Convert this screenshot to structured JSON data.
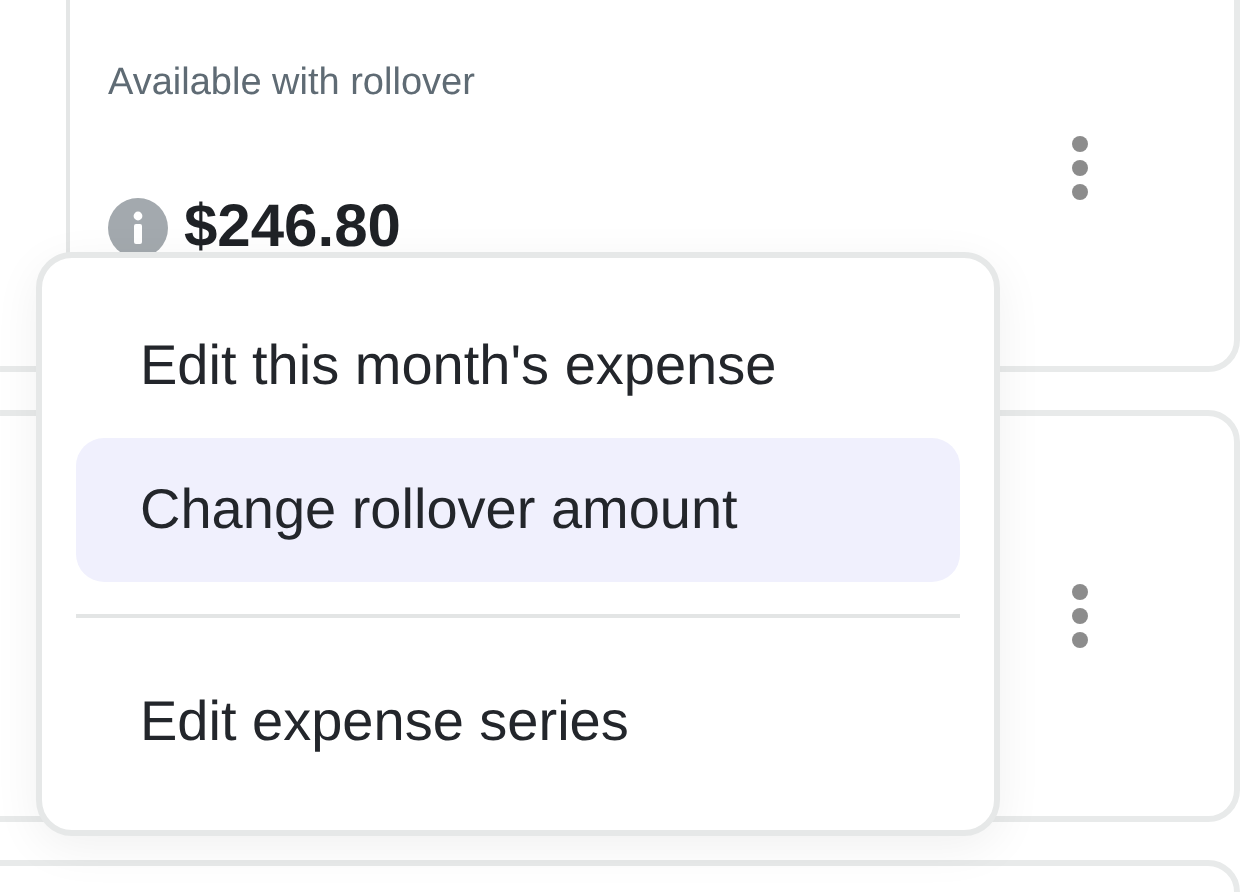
{
  "budget_card": {
    "label": "Available with rollover",
    "amount": "$246.80"
  },
  "menu": {
    "items": [
      {
        "kind": "action",
        "label": "Edit this month's expense",
        "selected": false
      },
      {
        "kind": "action",
        "label": "Change rollover amount",
        "selected": true
      },
      {
        "kind": "divider"
      },
      {
        "kind": "action",
        "label": "Edit expense series",
        "selected": false
      }
    ]
  }
}
